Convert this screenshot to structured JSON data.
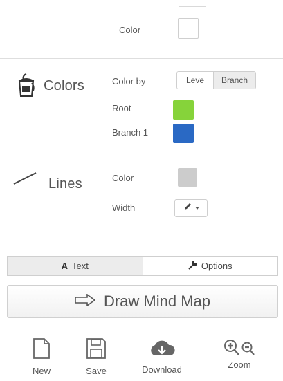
{
  "colors_panel": {
    "top_color_label": "Color",
    "top_color_value": "#ffffff"
  },
  "colors_section": {
    "title": "Colors",
    "color_by_label": "Color by",
    "color_by_options": [
      "Leve",
      "Branch"
    ],
    "color_by_selected": "Branch",
    "root_label": "Root",
    "root_color": "#86d33a",
    "branch_label": "Branch 1",
    "branch_color": "#2a69c4"
  },
  "lines_section": {
    "title": "Lines",
    "color_label": "Color",
    "color_value": "#cccccc",
    "width_label": "Width"
  },
  "tabs": [
    {
      "label": "Text",
      "icon": "text-a-icon",
      "active": true
    },
    {
      "label": "Options",
      "icon": "wrench-icon",
      "active": false
    }
  ],
  "draw_button": {
    "label": "Draw Mind Map"
  },
  "toolbar": {
    "new_label": "New",
    "save_label": "Save",
    "download_label": "Download",
    "zoom_label": "Zoom"
  }
}
